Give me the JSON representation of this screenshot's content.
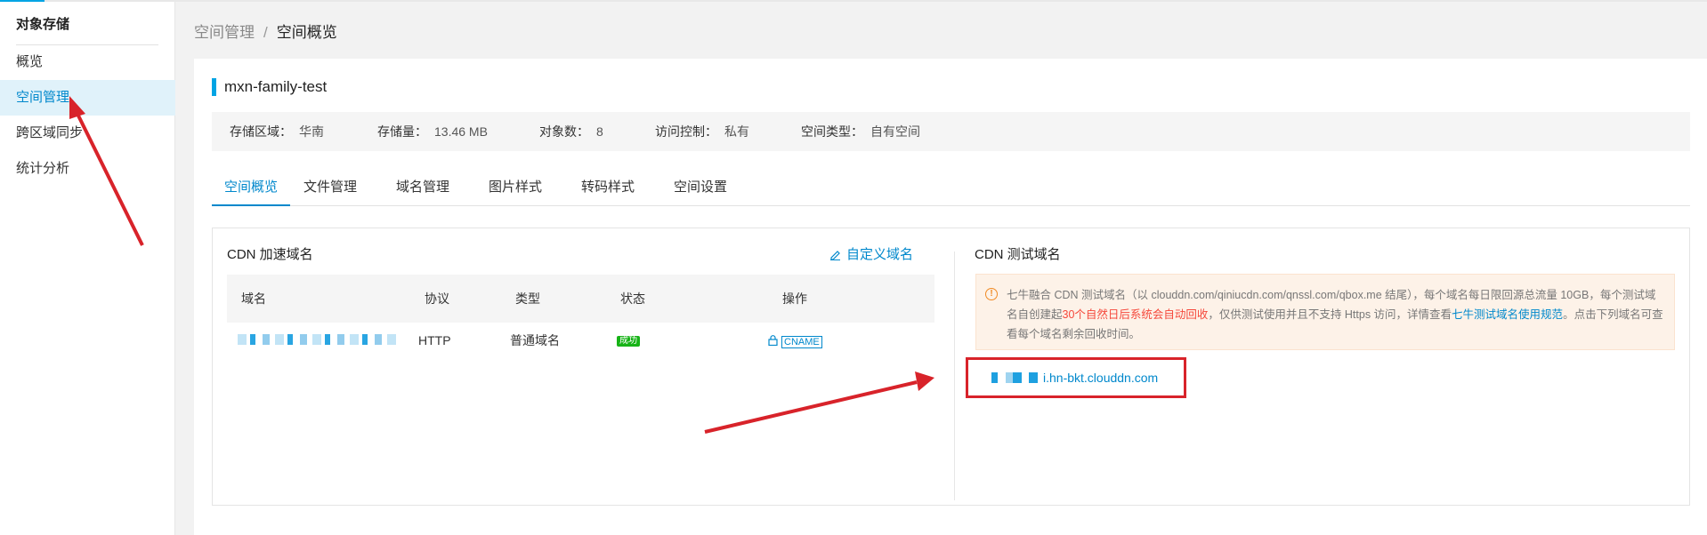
{
  "sidebar": {
    "title": "对象存储",
    "items": [
      {
        "label": "概览"
      },
      {
        "label": "空间管理"
      },
      {
        "label": "跨区域同步"
      },
      {
        "label": "统计分析"
      }
    ]
  },
  "breadcrumb": {
    "parent": "空间管理",
    "separator": "/",
    "current": "空间概览"
  },
  "bucket": {
    "name": "mxn-family-test"
  },
  "info": {
    "region_label": "存储区域：",
    "region_value": "华南",
    "storage_label": "存储量：",
    "storage_value": "13.46 MB",
    "objects_label": "对象数：",
    "objects_value": "8",
    "access_label": "访问控制：",
    "access_value": "私有",
    "type_label": "空间类型：",
    "type_value": "自有空间"
  },
  "tabs": [
    {
      "label": "空间概览"
    },
    {
      "label": "文件管理"
    },
    {
      "label": "域名管理"
    },
    {
      "label": "图片样式"
    },
    {
      "label": "转码样式"
    },
    {
      "label": "空间设置"
    }
  ],
  "cdn": {
    "title": "CDN 加速域名",
    "custom_link": "自定义域名",
    "columns": [
      "域名",
      "协议",
      "类型",
      "状态",
      "操作"
    ],
    "row": {
      "protocol": "HTTP",
      "type": "普通域名",
      "status": "成功",
      "action": "CNAME"
    }
  },
  "test": {
    "title": "CDN 测试域名",
    "notice_part1": "七牛融合 CDN 测试域名（以 clouddn.com/qiniucdn.com/qnssl.com/qbox.me 结尾），每个域名每日限回源总流量 10GB，每个测试域名自创建起",
    "notice_red": "30个自然日后系统会自动回收",
    "notice_part2": "，仅供测试使用并且不支持 Https 访问，详情查看",
    "notice_link": "七牛测试域名使用规范",
    "notice_part3": "。点击下列域名可查看每个域名剩余回收时间。",
    "domain": "i.hn-bkt.clouddn.com"
  },
  "colors": {
    "accent": "#0088cc",
    "highlight_box": "#d8232a",
    "success": "#17b317"
  }
}
